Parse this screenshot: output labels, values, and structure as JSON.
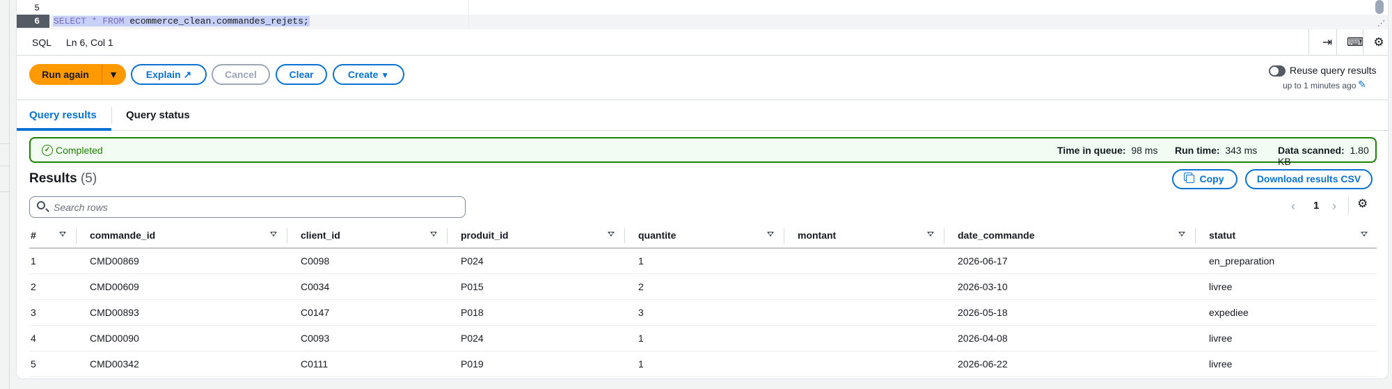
{
  "editor": {
    "lines": [
      {
        "num": "5",
        "text": ""
      },
      {
        "num": "6",
        "kw1": "SELECT",
        "op": " * ",
        "kw2": "FROM",
        "ident": " ecommerce_clean.commandes_rejets;"
      }
    ]
  },
  "statusbar": {
    "language": "SQL",
    "position": "Ln 6, Col 1"
  },
  "actions": {
    "run_again": "Run again",
    "explain": "Explain",
    "cancel": "Cancel",
    "clear": "Clear",
    "create": "Create",
    "reuse_label": "Reuse query results",
    "reuse_sub": "up to 1 minutes ago"
  },
  "tabs": [
    {
      "label": "Query results",
      "active": true
    },
    {
      "label": "Query status",
      "active": false
    }
  ],
  "banner": {
    "status": "Completed",
    "time_in_queue_label": "Time in queue:",
    "time_in_queue": "98 ms",
    "run_time_label": "Run time:",
    "run_time": "343 ms",
    "data_scanned_label": "Data scanned:",
    "data_scanned": "1.80 KB"
  },
  "results": {
    "title": "Results",
    "count": "(5)",
    "copy": "Copy",
    "download": "Download results CSV",
    "search_placeholder": "Search rows",
    "page": "1"
  },
  "table": {
    "columns": [
      "#",
      "commande_id",
      "client_id",
      "produit_id",
      "quantite",
      "montant",
      "date_commande",
      "statut"
    ],
    "rows": [
      [
        "1",
        "CMD00869",
        "C0098",
        "P024",
        "1",
        "",
        "2026-06-17",
        "en_preparation"
      ],
      [
        "2",
        "CMD00609",
        "C0034",
        "P015",
        "2",
        "",
        "2026-03-10",
        "livree"
      ],
      [
        "3",
        "CMD00893",
        "C0147",
        "P018",
        "3",
        "",
        "2026-05-18",
        "expediee"
      ],
      [
        "4",
        "CMD00090",
        "C0093",
        "P024",
        "1",
        "",
        "2026-04-08",
        "livree"
      ],
      [
        "5",
        "CMD00342",
        "C0111",
        "P019",
        "1",
        "",
        "2026-06-22",
        "livree"
      ]
    ]
  }
}
